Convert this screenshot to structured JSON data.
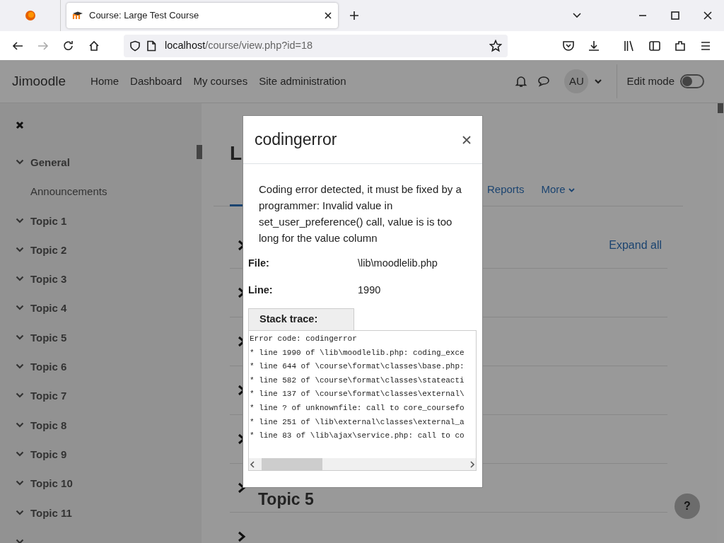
{
  "browser": {
    "tabs": [
      {
        "title": "Course: Large Test Course",
        "selected": true
      }
    ],
    "url": {
      "host": "localhost",
      "path": "/course/view.php?id=18"
    }
  },
  "navbar": {
    "brand": "Jimoodle",
    "links": [
      {
        "label": "Home"
      },
      {
        "label": "Dashboard"
      },
      {
        "label": "My courses"
      },
      {
        "label": "Site administration"
      }
    ],
    "avatar": "AU",
    "edit_mode": {
      "label": "Edit mode",
      "on": false
    }
  },
  "course_index": {
    "items": [
      {
        "label": "General",
        "expanded": true,
        "children": [
          {
            "label": "Announcements"
          }
        ]
      },
      {
        "label": "Topic 1",
        "expanded": true
      },
      {
        "label": "Topic 2",
        "expanded": true
      },
      {
        "label": "Topic 3",
        "expanded": true
      },
      {
        "label": "Topic 4",
        "expanded": true
      },
      {
        "label": "Topic 5",
        "expanded": true
      },
      {
        "label": "Topic 6",
        "expanded": true
      },
      {
        "label": "Topic 7",
        "expanded": true
      },
      {
        "label": "Topic 8",
        "expanded": true
      },
      {
        "label": "Topic 9",
        "expanded": true
      },
      {
        "label": "Topic 10",
        "expanded": true
      },
      {
        "label": "Topic 11",
        "expanded": true
      },
      {
        "expanded": true
      }
    ]
  },
  "course": {
    "title": "L",
    "tabs": [
      {
        "label": "Reports"
      },
      {
        "label": "More",
        "dropdown": true
      }
    ],
    "expand_all": "Expand all",
    "sections": [
      {
        "expanded": false
      },
      {
        "expanded": false
      },
      {
        "expanded": false
      },
      {
        "expanded": false
      },
      {
        "expanded": false
      },
      {
        "title": "Topic 5",
        "expanded": false
      },
      {
        "expanded": false
      }
    ]
  },
  "modal": {
    "title": "codingerror",
    "message": "Coding error detected, it must be fixed by a programmer: Invalid value in set_user_preference() call, value is is too long for the value column",
    "fields": [
      {
        "label": "File:",
        "value": "\\lib\\moodlelib.php"
      },
      {
        "label": "Line:",
        "value": "1990"
      }
    ],
    "stack_trace": {
      "label": "Stack trace:",
      "lines": [
        "Error code: codingerror",
        "* line 1990 of \\lib\\moodlelib.php: coding_exce",
        "* line 644 of \\course\\format\\classes\\base.php:",
        "* line 582 of \\course\\format\\classes\\stateacti",
        "* line 137 of \\course\\format\\classes\\external\\",
        "* line ? of unknownfile: call to core_coursefo",
        "* line 251 of \\lib\\external\\classes\\external_a",
        "* line 83 of \\lib\\ajax\\service.php: call to co"
      ]
    }
  },
  "help": "?"
}
